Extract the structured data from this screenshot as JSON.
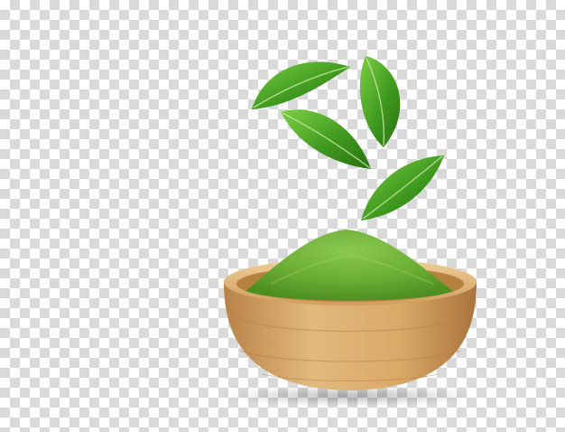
{
  "image": {
    "background": "transparency-checkerboard",
    "subject": "matcha-powder-in-wooden-bowl-with-tea-leaves"
  },
  "colors": {
    "checker_light": "#ffffff",
    "checker_dark": "#d9d9d9",
    "leaf_dark": "#2f7d14",
    "leaf_light": "#6fc23a",
    "powder": "#6fb238",
    "powder_shadow": "#4f8f22",
    "wood_light": "#e2b77a",
    "wood_mid": "#c8955a",
    "wood_dark": "#a9743d"
  }
}
